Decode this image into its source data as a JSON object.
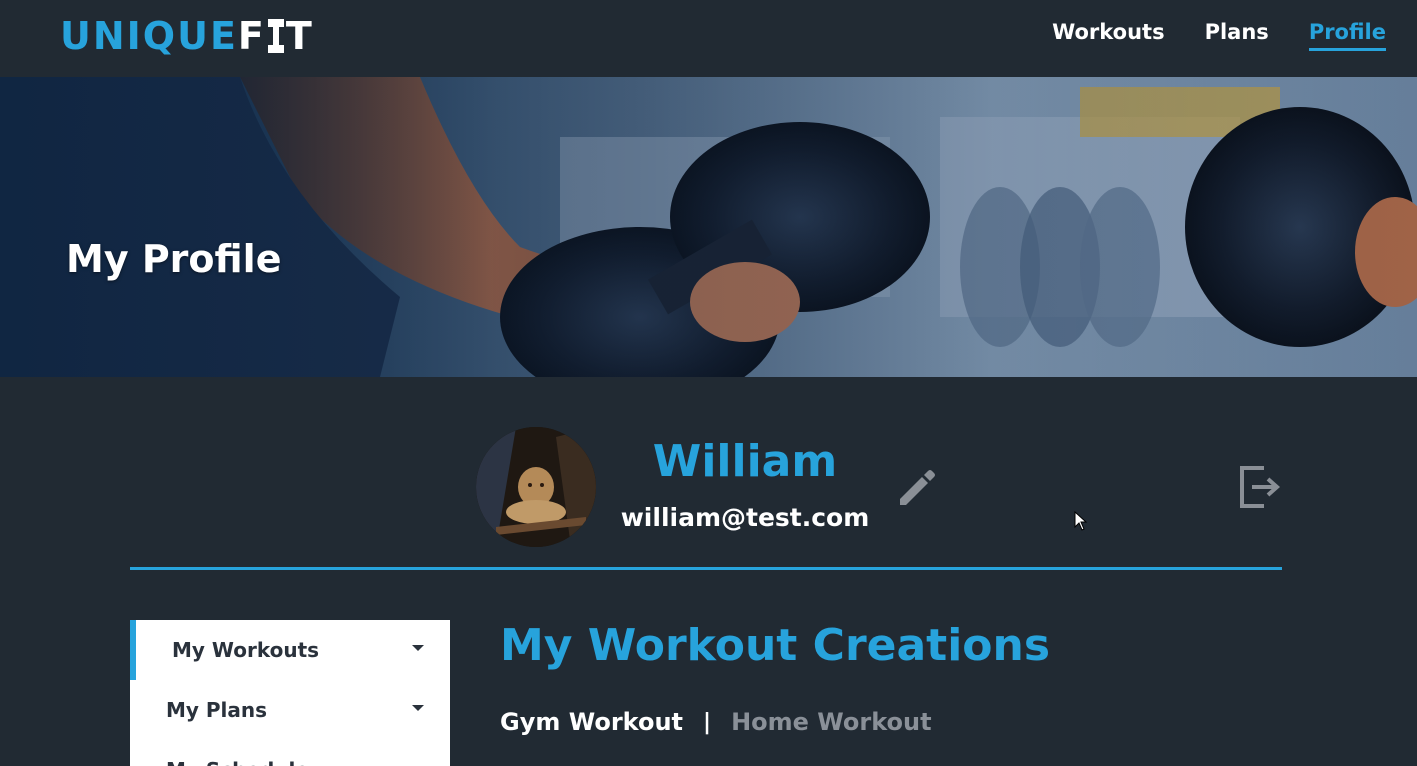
{
  "brand": {
    "logo_part1": "UNIQUE",
    "logo_part2": "F",
    "logo_part3": "T",
    "accent": "#27a3dc"
  },
  "nav": {
    "items": [
      {
        "label": "Workouts",
        "active": false
      },
      {
        "label": "Plans",
        "active": false
      },
      {
        "label": "Profile",
        "active": true
      }
    ]
  },
  "hero": {
    "title": "My Profile"
  },
  "profile": {
    "name": "William",
    "email": "william@test.com",
    "edit_icon": "pencil-icon",
    "logout_icon": "logout-icon"
  },
  "sidebar": {
    "items": [
      {
        "label": "My Workouts",
        "active": true
      },
      {
        "label": "My Plans",
        "active": false
      },
      {
        "label": "My Schedule",
        "active": false
      }
    ]
  },
  "main": {
    "title": "My Workout Creations",
    "tabs": [
      {
        "label": "Gym Workout",
        "active": true
      },
      {
        "label": "Home Workout",
        "active": false
      }
    ],
    "tab_separator": "|"
  }
}
